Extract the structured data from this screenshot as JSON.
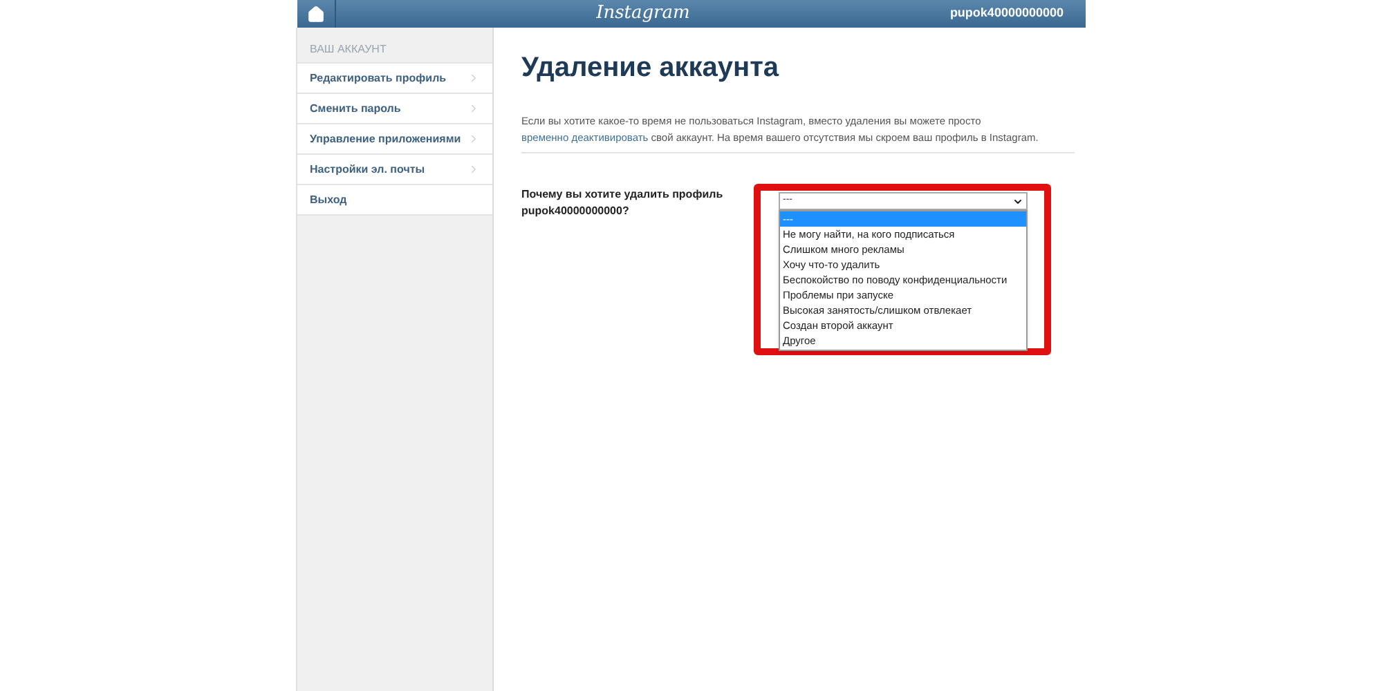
{
  "header": {
    "logo": "Instagram",
    "username": "pupok40000000000"
  },
  "sidebar": {
    "heading": "ВАШ АККАУНТ",
    "items": [
      {
        "label": "Редактировать профиль",
        "chevron": true
      },
      {
        "label": "Сменить пароль",
        "chevron": true
      },
      {
        "label": "Управление приложениями",
        "chevron": true
      },
      {
        "label": "Настройки эл. почты",
        "chevron": true
      },
      {
        "label": "Выход",
        "chevron": false
      }
    ]
  },
  "page": {
    "title": "Удаление аккаунта",
    "intro": "Если вы хотите какое-то время не пользоваться Instagram, вместо удаления вы можете просто",
    "intro_link": "временно деактивировать",
    "intro_end": "свой аккаунт. На время вашего отсутствия мы скроем ваш профиль в Instagram.",
    "question": "Почему вы хотите удалить профиль pupok40000000000?",
    "select": {
      "value": "---",
      "options": [
        {
          "label": "---",
          "selected": true
        },
        {
          "label": "Не могу найти, на кого подписаться",
          "selected": false
        },
        {
          "label": "Слишком много рекламы",
          "selected": false
        },
        {
          "label": "Хочу что-то удалить",
          "selected": false
        },
        {
          "label": "Беспокойство по поводу конфиденциальности",
          "selected": false
        },
        {
          "label": "Проблемы при запуске",
          "selected": false
        },
        {
          "label": "Высокая занятость/слишком отвлекает",
          "selected": false
        },
        {
          "label": "Создан второй аккаунт",
          "selected": false
        },
        {
          "label": "Другое",
          "selected": false
        }
      ]
    }
  }
}
